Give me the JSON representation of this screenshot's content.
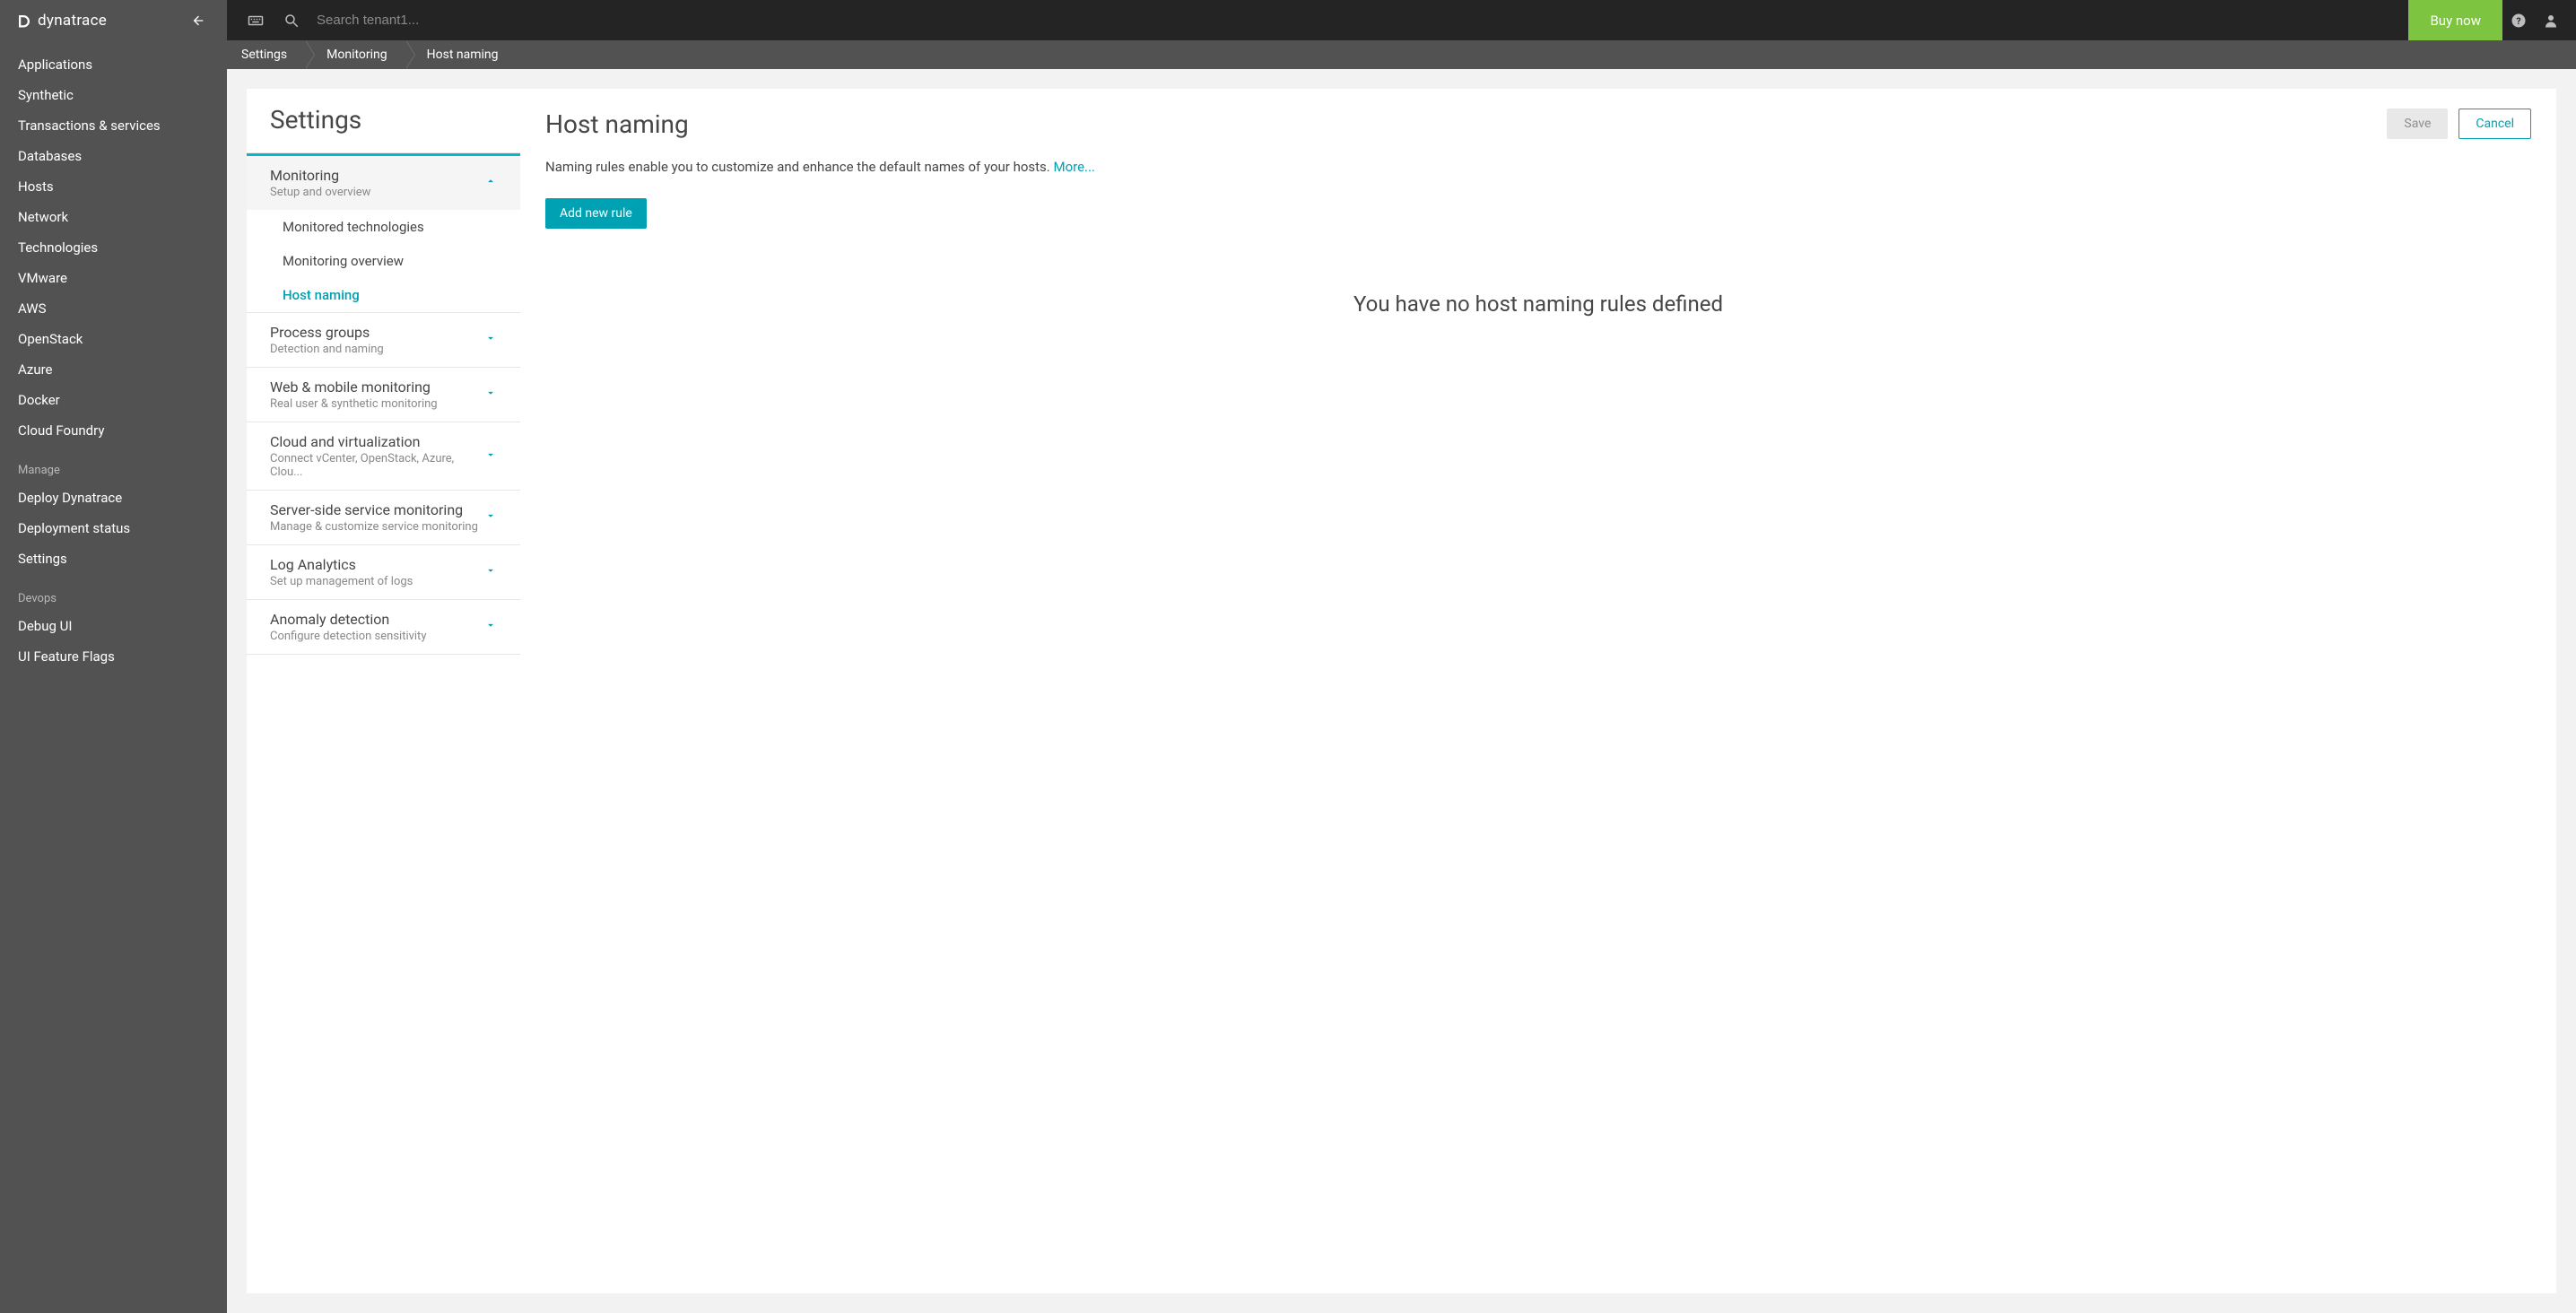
{
  "brand": "dynatrace",
  "topbar": {
    "search_placeholder": "Search tenant1...",
    "buy_now": "Buy now"
  },
  "sidebar": {
    "items": [
      "Applications",
      "Synthetic",
      "Transactions & services",
      "Databases",
      "Hosts",
      "Network",
      "Technologies",
      "VMware",
      "AWS",
      "OpenStack",
      "Azure",
      "Docker",
      "Cloud Foundry"
    ],
    "sections": [
      {
        "label": "Manage",
        "items": [
          "Deploy Dynatrace",
          "Deployment status",
          "Settings"
        ]
      },
      {
        "label": "Devops",
        "items": [
          "Debug UI",
          "UI Feature Flags"
        ]
      }
    ]
  },
  "breadcrumb": [
    "Settings",
    "Monitoring",
    "Host naming"
  ],
  "settings": {
    "title": "Settings",
    "categories": [
      {
        "title": "Monitoring",
        "subtitle": "Setup and overview",
        "expanded": true,
        "children": [
          "Monitored technologies",
          "Monitoring overview",
          "Host naming"
        ],
        "active_child": "Host naming"
      },
      {
        "title": "Process groups",
        "subtitle": "Detection and naming",
        "expanded": false
      },
      {
        "title": "Web & mobile monitoring",
        "subtitle": "Real user & synthetic monitoring",
        "expanded": false
      },
      {
        "title": "Cloud and virtualization",
        "subtitle": "Connect vCenter, OpenStack, Azure, Clou...",
        "expanded": false
      },
      {
        "title": "Server-side service monitoring",
        "subtitle": "Manage & customize service monitoring",
        "expanded": false
      },
      {
        "title": "Log Analytics",
        "subtitle": "Set up management of logs",
        "expanded": false
      },
      {
        "title": "Anomaly detection",
        "subtitle": "Configure detection sensitivity",
        "expanded": false
      }
    ]
  },
  "page": {
    "title": "Host naming",
    "save": "Save",
    "cancel": "Cancel",
    "description": "Naming rules enable you to customize and enhance the default names of your hosts. ",
    "more": "More...",
    "add_rule": "Add new rule",
    "empty": "You have no host naming rules defined"
  }
}
